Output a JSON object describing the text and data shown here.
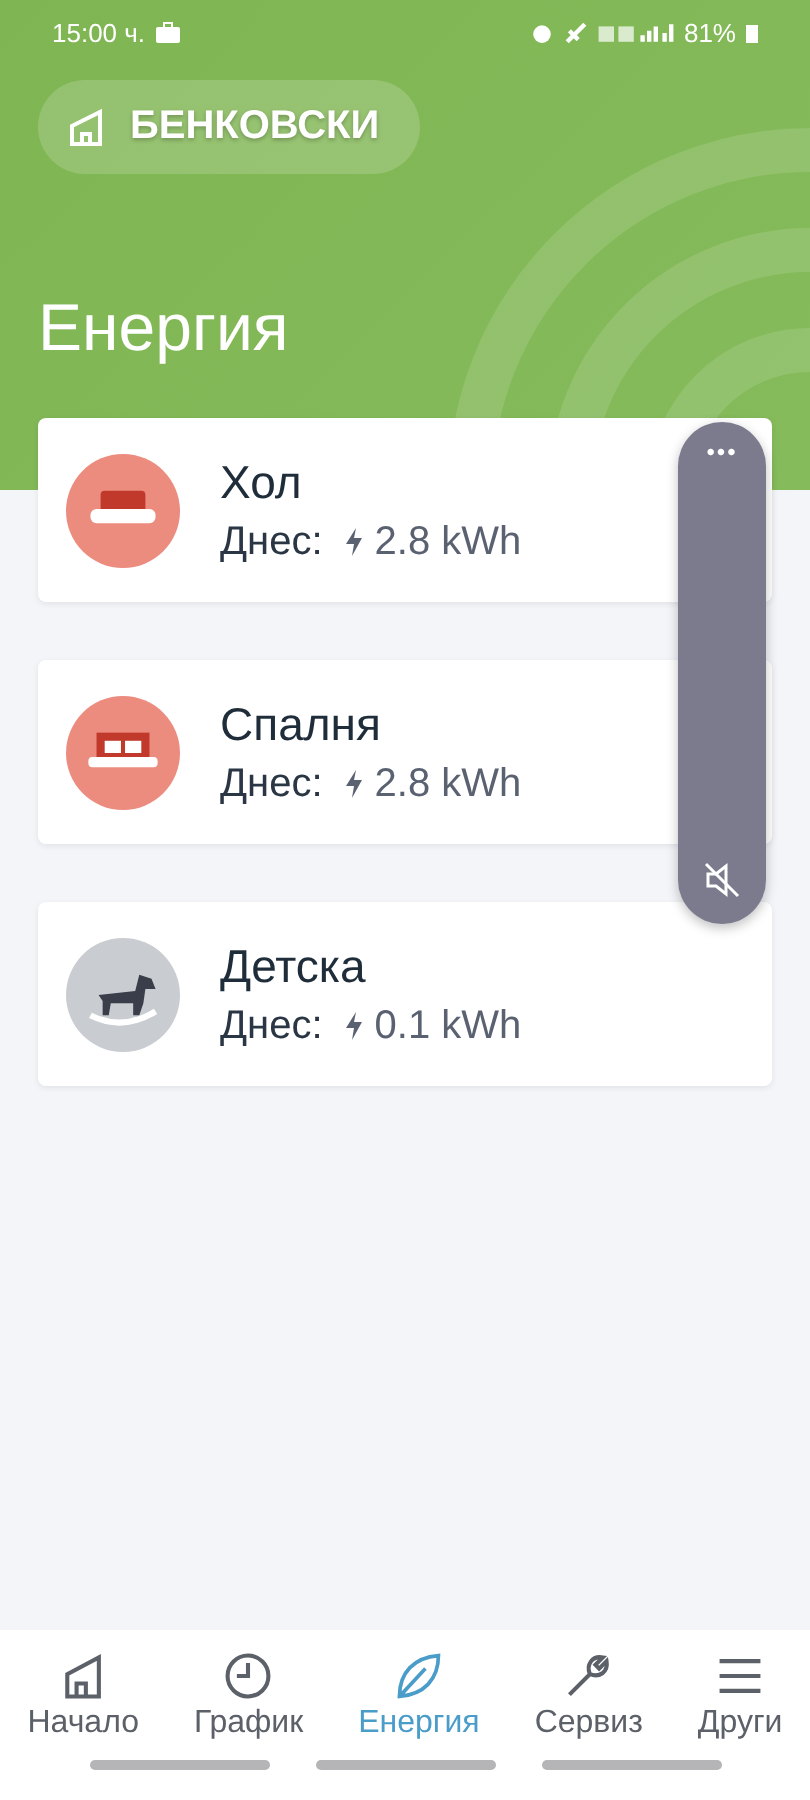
{
  "status_bar": {
    "time": "15:00 ч.",
    "battery": "81%"
  },
  "home_chip": {
    "label": "БЕНКОВСКИ"
  },
  "title": "Енергия",
  "rooms": [
    {
      "name": "Хол",
      "today_label": "Днес:",
      "energy": "2.8 kWh",
      "kind": "sofa",
      "color": "#ec8c7f"
    },
    {
      "name": "Спалня",
      "today_label": "Днес:",
      "energy": "2.8 kWh",
      "kind": "bed",
      "color": "#ec8c7f"
    },
    {
      "name": "Детска",
      "today_label": "Днес:",
      "energy": "0.1 kWh",
      "kind": "horse",
      "color": "#c9ccd0"
    }
  ],
  "volume_panel": {
    "more": "•••"
  },
  "nav": [
    {
      "label": "Начало",
      "kind": "home",
      "selected": false
    },
    {
      "label": "График",
      "kind": "clock",
      "selected": false
    },
    {
      "label": "Енергия",
      "kind": "leaf",
      "selected": true
    },
    {
      "label": "Сервиз",
      "kind": "wrench",
      "selected": false
    },
    {
      "label": "Други",
      "kind": "menu",
      "selected": false
    }
  ]
}
